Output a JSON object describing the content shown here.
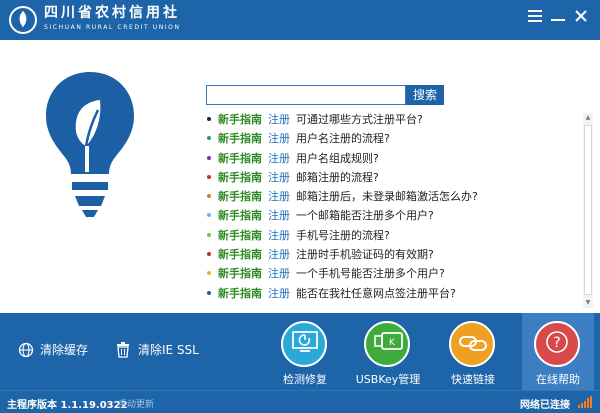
{
  "header": {
    "title_cn": "四川省农村信用社",
    "title_en": "SICHUAN RURAL CREDIT UNION",
    "menu_icon": "menu-icon",
    "minimize_icon": "minimize-icon",
    "close_icon": "close-icon"
  },
  "search": {
    "value": "",
    "placeholder": "",
    "button_label": "搜索"
  },
  "faq": {
    "guide_label": "新手指南",
    "reg_label": "注册",
    "items": [
      {
        "text": "可通过哪些方式注册平台?",
        "dot_color": "#1f2a44"
      },
      {
        "text": "用户名注册的流程?",
        "dot_color": "#1a9a7a"
      },
      {
        "text": "用户名组成规则?",
        "dot_color": "#7b2fb5"
      },
      {
        "text": "邮箱注册的流程?",
        "dot_color": "#d12b2b"
      },
      {
        "text": "邮箱注册后，未登录邮箱激活怎么办?",
        "dot_color": "#e07a1a"
      },
      {
        "text": "一个邮箱能否注册多个用户?",
        "dot_color": "#6fb7e8"
      },
      {
        "text": "手机号注册的流程?",
        "dot_color": "#7fc23a"
      },
      {
        "text": "注册时手机验证码的有效期?",
        "dot_color": "#d12b2b"
      },
      {
        "text": "一个手机号能否注册多个用户?",
        "dot_color": "#e6b81a"
      },
      {
        "text": "能否在我社任意网点签注册平台?",
        "dot_color": "#1f5fa8"
      }
    ]
  },
  "utilities": {
    "clear_cache": "清除缓存",
    "clear_ie_ssl": "清除IE SSL"
  },
  "tiles": [
    {
      "label": "检测修复",
      "color": "#2aa8d8",
      "icon": "monitor-icon"
    },
    {
      "label": "USBKey管理",
      "color": "#3eab3a",
      "icon": "usbkey-icon"
    },
    {
      "label": "快速链接",
      "color": "#f0a020",
      "icon": "link-icon"
    },
    {
      "label": "在线帮助",
      "color": "#d84a4a",
      "icon": "help-icon"
    }
  ],
  "status": {
    "version": "主程序版本 1.1.19.0322",
    "update_link": "手动更新",
    "network": "网络已连接"
  },
  "colors": {
    "primary": "#1d64a8",
    "bulb": "#1d5fa5"
  }
}
